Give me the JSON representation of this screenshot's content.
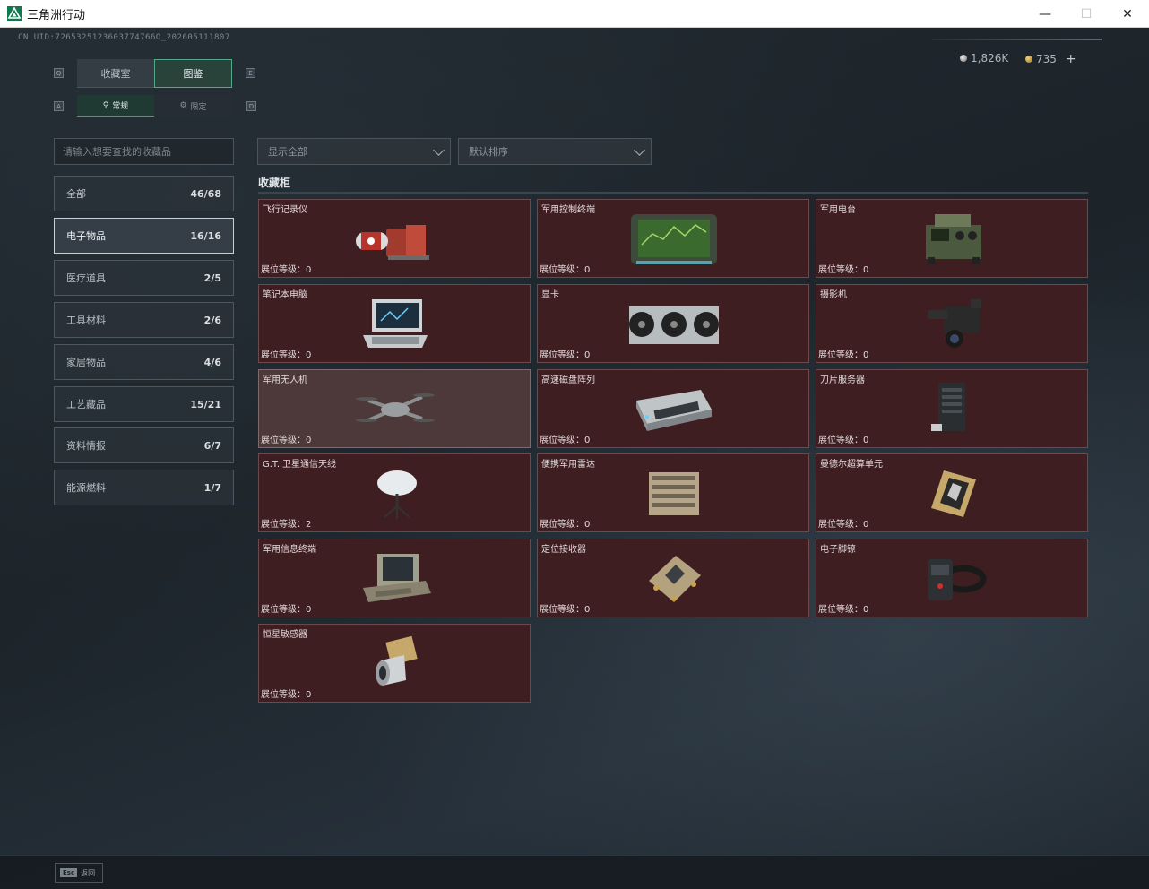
{
  "window": {
    "title": "三角洲行动",
    "minimize": "—",
    "maximize": "☐",
    "close": "✕"
  },
  "header": {
    "uid": "CN UID:7265325123603774766O_202605111807"
  },
  "currency": {
    "silver": "1,826K",
    "gold": "735",
    "add": "+"
  },
  "tabs": [
    {
      "label": "收藏室",
      "active": false
    },
    {
      "label": "图鉴",
      "active": true
    }
  ],
  "subtabs": [
    {
      "label": "常规",
      "active": true
    },
    {
      "label": "限定",
      "active": false
    }
  ],
  "keyhints": {
    "tab_left": "Q",
    "tab_right": "E",
    "sub_left": "A",
    "sub_right": "D"
  },
  "search": {
    "placeholder": "请输入想要查找的收藏品"
  },
  "filters": {
    "display": "显示全部",
    "sort": "默认排序"
  },
  "categories": [
    {
      "label": "全部",
      "count": "46/68",
      "active": false
    },
    {
      "label": "电子物品",
      "count": "16/16",
      "active": true
    },
    {
      "label": "医疗道具",
      "count": "2/5",
      "active": false
    },
    {
      "label": "工具材料",
      "count": "2/6",
      "active": false
    },
    {
      "label": "家居物品",
      "count": "4/6",
      "active": false
    },
    {
      "label": "工艺藏品",
      "count": "15/21",
      "active": false
    },
    {
      "label": "资料情报",
      "count": "6/7",
      "active": false
    },
    {
      "label": "能源燃料",
      "count": "1/7",
      "active": false
    }
  ],
  "cabinet": {
    "title": "收藏柜",
    "level_label": "展位等级：",
    "items": [
      {
        "name": "飞行记录仪",
        "level": "0",
        "icon": "flight-recorder-icon"
      },
      {
        "name": "军用控制终端",
        "level": "0",
        "icon": "control-terminal-icon"
      },
      {
        "name": "军用电台",
        "level": "0",
        "icon": "military-radio-icon"
      },
      {
        "name": "笔记本电脑",
        "level": "0",
        "icon": "laptop-icon"
      },
      {
        "name": "显卡",
        "level": "0",
        "icon": "graphics-card-icon"
      },
      {
        "name": "摄影机",
        "level": "0",
        "icon": "camera-icon"
      },
      {
        "name": "军用无人机",
        "level": "0",
        "icon": "drone-icon",
        "highlight": true
      },
      {
        "name": "高速磁盘阵列",
        "level": "0",
        "icon": "disk-array-icon"
      },
      {
        "name": "刀片服务器",
        "level": "0",
        "icon": "blade-server-icon"
      },
      {
        "name": "G.T.I卫星通信天线",
        "level": "2",
        "icon": "satellite-antenna-icon"
      },
      {
        "name": "便携军用雷达",
        "level": "0",
        "icon": "portable-radar-icon"
      },
      {
        "name": "曼德尔超算单元",
        "level": "0",
        "icon": "supercomputer-unit-icon"
      },
      {
        "name": "军用信息终端",
        "level": "0",
        "icon": "info-terminal-icon"
      },
      {
        "name": "定位接收器",
        "level": "0",
        "icon": "gps-receiver-icon"
      },
      {
        "name": "电子脚镣",
        "level": "0",
        "icon": "ankle-monitor-icon"
      },
      {
        "name": "恒星敏感器",
        "level": "0",
        "icon": "star-sensor-icon"
      }
    ]
  },
  "bottom": {
    "esc_key": "Esc",
    "esc_label": "返回"
  },
  "colors": {
    "accent": "#53a889",
    "slot_bg": "#3f1e22",
    "slot_highlight": "#4e393a"
  }
}
